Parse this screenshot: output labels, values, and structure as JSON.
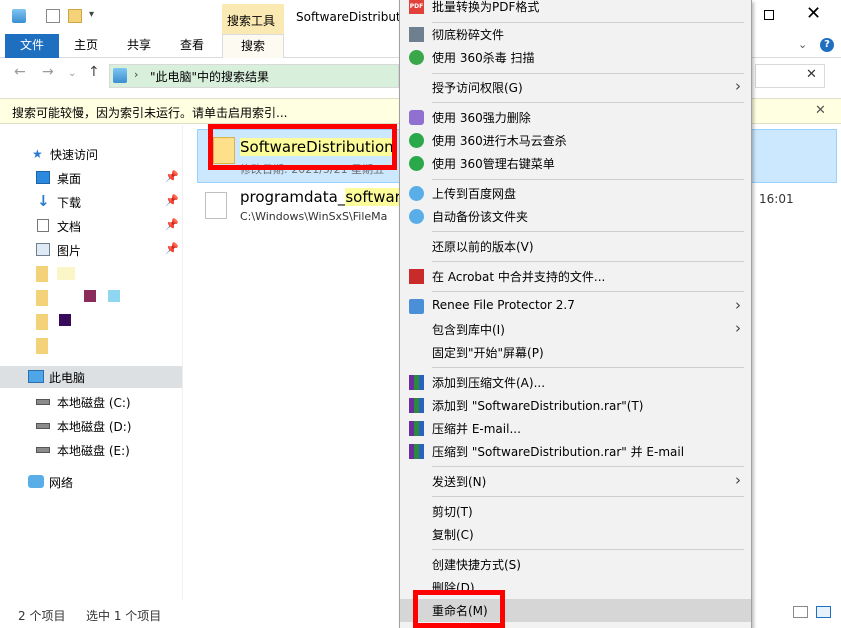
{
  "window": {
    "title": "SoftwareDistributi",
    "context_tab": "搜索工具",
    "close_glyph": "✕"
  },
  "ribbon": {
    "tabs": [
      "文件",
      "主页",
      "共享",
      "查看",
      "搜索"
    ],
    "help": "?"
  },
  "address": {
    "path_text": "\"此电脑\"中的搜索结果",
    "search_clear": "✕"
  },
  "infobar": {
    "text": "搜索可能较慢，因为索引未运行。请单击启用索引...",
    "close": "✕"
  },
  "nav": {
    "quick_access": "快速访问",
    "items": [
      {
        "label": "桌面",
        "icon": "desktop-icon"
      },
      {
        "label": "下载",
        "icon": "download-icon"
      },
      {
        "label": "文档",
        "icon": "document-icon"
      },
      {
        "label": "图片",
        "icon": "picture-icon"
      }
    ],
    "this_pc": "此电脑",
    "drives": [
      "本地磁盘 (C:)",
      "本地磁盘 (D:)",
      "本地磁盘 (E:)"
    ],
    "network": "网络"
  },
  "files": [
    {
      "name": "SoftwareDistribution",
      "meta": "修改日期: 2021/5/21 星期五",
      "icon": "folder-icon"
    },
    {
      "name_prefix": "programdata_",
      "name_highlight": "softwar",
      "path": "C:\\Windows\\WinSxS\\FileMa",
      "time": "16:01",
      "icon": "file-icon"
    }
  ],
  "status": {
    "count": "2 个项目",
    "selected": "选中 1 个项目"
  },
  "menu": {
    "items": [
      {
        "label": "批量转换为PDF格式",
        "icon": "pdf-icon"
      },
      {
        "label": "彻底粉碎文件",
        "icon": "shredder-icon"
      },
      {
        "label": "使用 360杀毒 扫描",
        "icon": "360-antivirus-icon"
      },
      {
        "label": "授予访问权限(G)",
        "submenu": true
      },
      {
        "label": "使用 360强力删除",
        "icon": "360-delete-icon"
      },
      {
        "label": "使用 360进行木马云查杀",
        "icon": "360-trojan-icon"
      },
      {
        "label": "使用 360管理右键菜单",
        "icon": "360-menu-icon"
      },
      {
        "label": "上传到百度网盘",
        "icon": "baidu-cloud-icon"
      },
      {
        "label": "自动备份该文件夹",
        "icon": "baidu-backup-icon"
      },
      {
        "label": "还原以前的版本(V)"
      },
      {
        "label": "在 Acrobat 中合并支持的文件...",
        "icon": "acrobat-icon"
      },
      {
        "label": "Renee File Protector 2.7",
        "icon": "renee-icon",
        "submenu": true
      },
      {
        "label": "包含到库中(I)",
        "submenu": true
      },
      {
        "label": "固定到\"开始\"屏幕(P)"
      },
      {
        "label": "添加到压缩文件(A)...",
        "icon": "winrar-icon"
      },
      {
        "label": "添加到 \"SoftwareDistribution.rar\"(T)",
        "icon": "winrar-icon"
      },
      {
        "label": "压缩并 E-mail...",
        "icon": "winrar-icon"
      },
      {
        "label": "压缩到 \"SoftwareDistribution.rar\" 并 E-mail",
        "icon": "winrar-icon"
      },
      {
        "label": "发送到(N)",
        "submenu": true
      },
      {
        "label": "剪切(T)"
      },
      {
        "label": "复制(C)"
      },
      {
        "label": "创建快捷方式(S)"
      },
      {
        "label": "删除(D)"
      },
      {
        "label": "重命名(M)"
      }
    ]
  },
  "colors": {
    "ribbon_file": "#1f6fc1",
    "context_tab": "#fbe9b4",
    "selection": "#cce8ff",
    "highlight": "#fcfc9b",
    "annotation_red": "#ff0000"
  }
}
